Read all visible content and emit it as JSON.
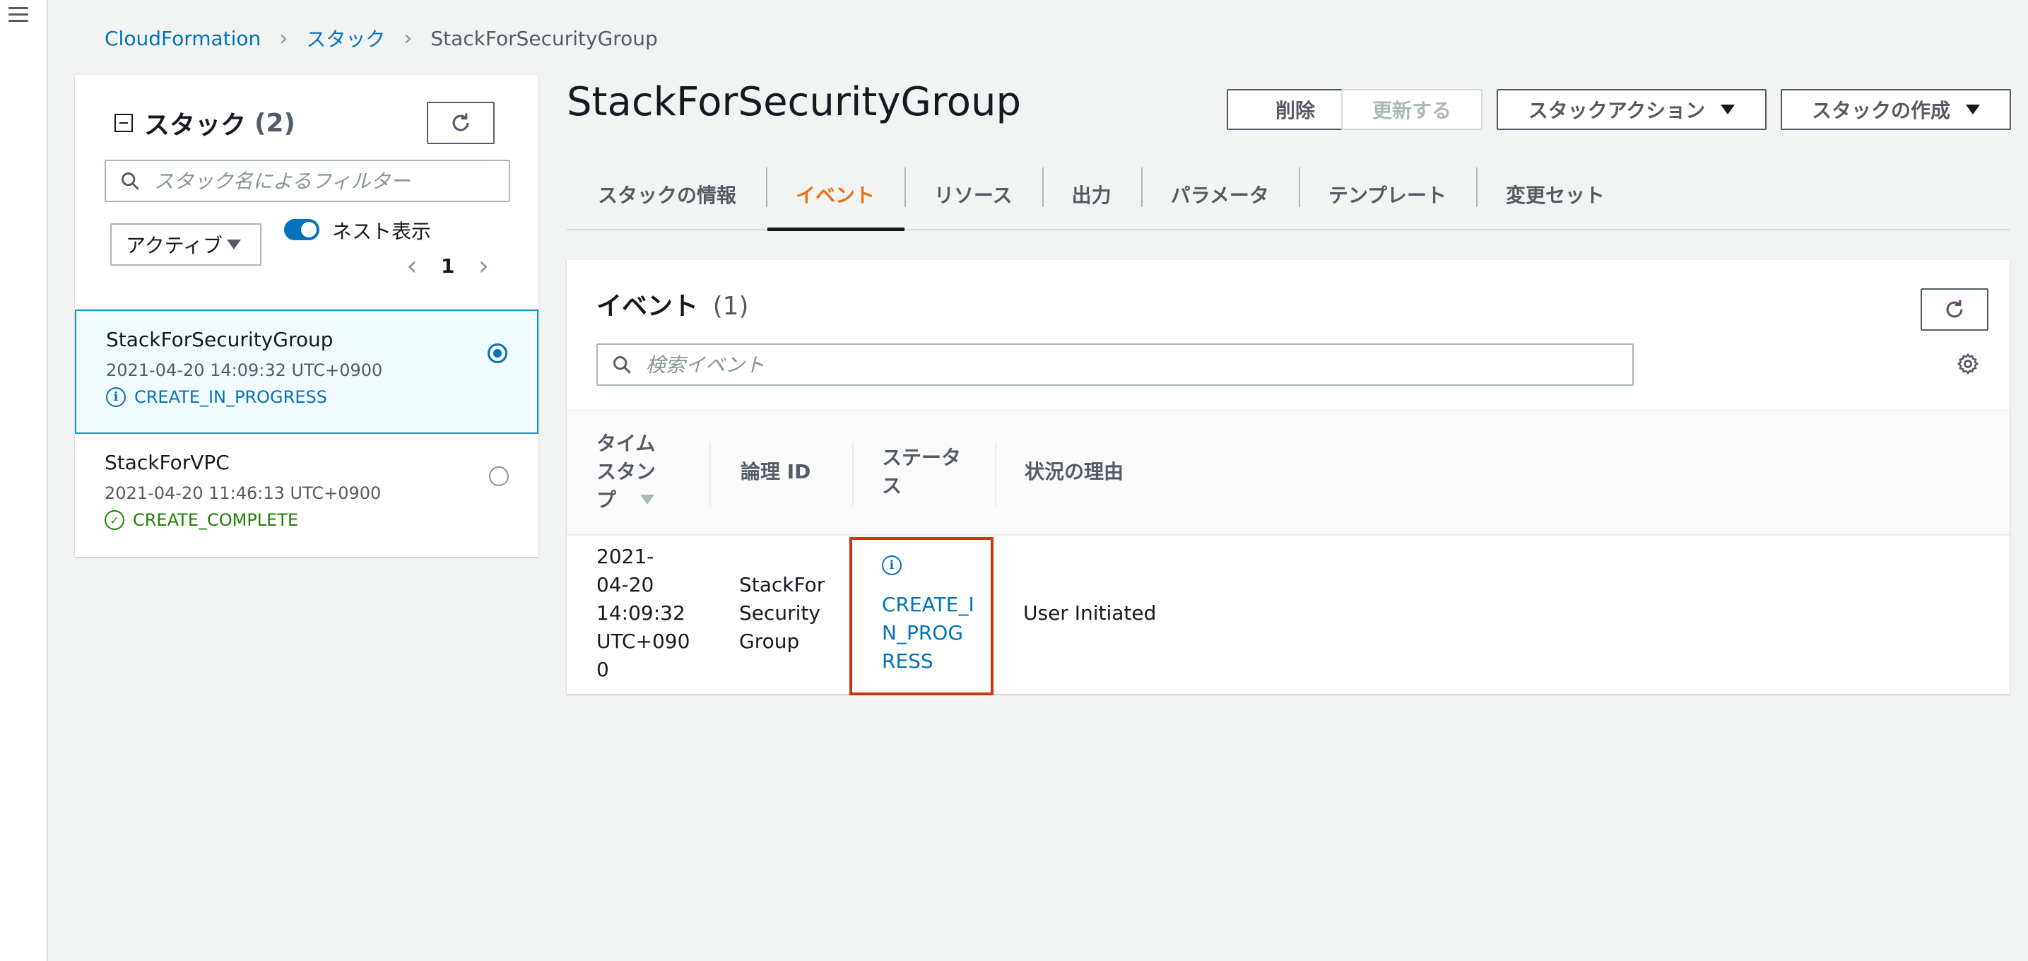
{
  "breadcrumb": {
    "items": [
      "CloudFormation",
      "スタック"
    ],
    "current": "StackForSecurityGroup"
  },
  "stacks_panel": {
    "title": "スタック",
    "count": "(2)",
    "filter_placeholder": "スタック名によるフィルター",
    "status_filter": "アクティブ",
    "nest_toggle_label": "ネスト表示",
    "nest_toggle_on": true,
    "page": "1",
    "items": [
      {
        "name": "StackForSecurityGroup",
        "date": "2021-04-20 14:09:32 UTC+0900",
        "status": "CREATE_IN_PROGRESS",
        "status_icon": "info-icon",
        "selected": true
      },
      {
        "name": "StackForVPC",
        "date": "2021-04-20 11:46:13 UTC+0900",
        "status": "CREATE_COMPLETE",
        "status_icon": "check-circle-icon",
        "selected": false
      }
    ]
  },
  "header": {
    "title": "StackForSecurityGroup",
    "buttons": {
      "delete": "削除",
      "update": "更新する",
      "stack_actions": "スタックアクション",
      "create_stack": "スタックの作成"
    }
  },
  "tabs": [
    {
      "label": "スタックの情報",
      "active": false
    },
    {
      "label": "イベント",
      "active": true
    },
    {
      "label": "リソース",
      "active": false
    },
    {
      "label": "出力",
      "active": false
    },
    {
      "label": "パラメータ",
      "active": false
    },
    {
      "label": "テンプレート",
      "active": false
    },
    {
      "label": "変更セット",
      "active": false
    }
  ],
  "events": {
    "title": "イベント",
    "count": "(1)",
    "search_placeholder": "検索イベント",
    "columns": {
      "timestamp": [
        "タイム",
        "スタン",
        "プ"
      ],
      "logical_id": "論理 ID",
      "status": [
        "ステータ",
        "ス"
      ],
      "reason": "状況の理由"
    },
    "rows": [
      {
        "timestamp": [
          "2021-",
          "04-20",
          "14:09:32",
          "UTC+090",
          "0"
        ],
        "logical_id": [
          "StackFor",
          "Security",
          "Group"
        ],
        "status": [
          "CREATE_I",
          "N_PROG",
          "RESS"
        ],
        "reason": "User Initiated"
      }
    ]
  },
  "colors": {
    "accent_blue": "#0073bb",
    "active_tab": "#ec7211",
    "success_green": "#1d8102",
    "highlight_red": "#d13212"
  }
}
